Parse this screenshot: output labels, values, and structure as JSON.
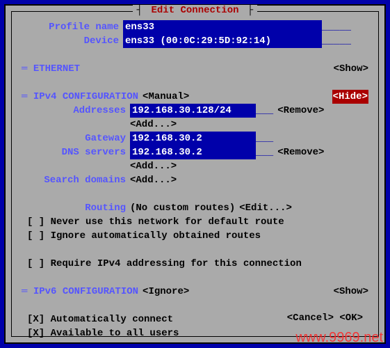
{
  "title": "Edit Connection",
  "profile": {
    "name_label": "Profile name",
    "name_value": "ens33",
    "device_label": "Device",
    "device_value": "ens33 (00:0C:29:5D:92:14)"
  },
  "ethernet": {
    "header": "ETHERNET",
    "show": "<Show>"
  },
  "ipv4": {
    "header": "IPv4 CONFIGURATION",
    "mode": "<Manual>",
    "hide": "<Hide>",
    "addresses_label": "Addresses",
    "addresses_value": "192.168.30.128/24",
    "remove": "<Remove>",
    "add": "<Add...>",
    "gateway_label": "Gateway",
    "gateway_value": "192.168.30.2",
    "dns_label": "DNS servers",
    "dns_value": "192.168.30.2",
    "search_label": "Search domains",
    "routing_label": "Routing",
    "routing_value": "(No custom routes)",
    "edit": "<Edit...>",
    "cb1": "[ ] Never use this network for default route",
    "cb2": "[ ] Ignore automatically obtained routes",
    "cb3": "[ ] Require IPv4 addressing for this connection"
  },
  "ipv6": {
    "header": "IPv6 CONFIGURATION",
    "mode": "<Ignore>",
    "show": "<Show>"
  },
  "general": {
    "cb1": "[X] Automatically connect",
    "cb2": "[X] Available to all users"
  },
  "buttons": {
    "cancel": "<Cancel>",
    "ok": "<OK>"
  },
  "watermark": "www.9969.net"
}
